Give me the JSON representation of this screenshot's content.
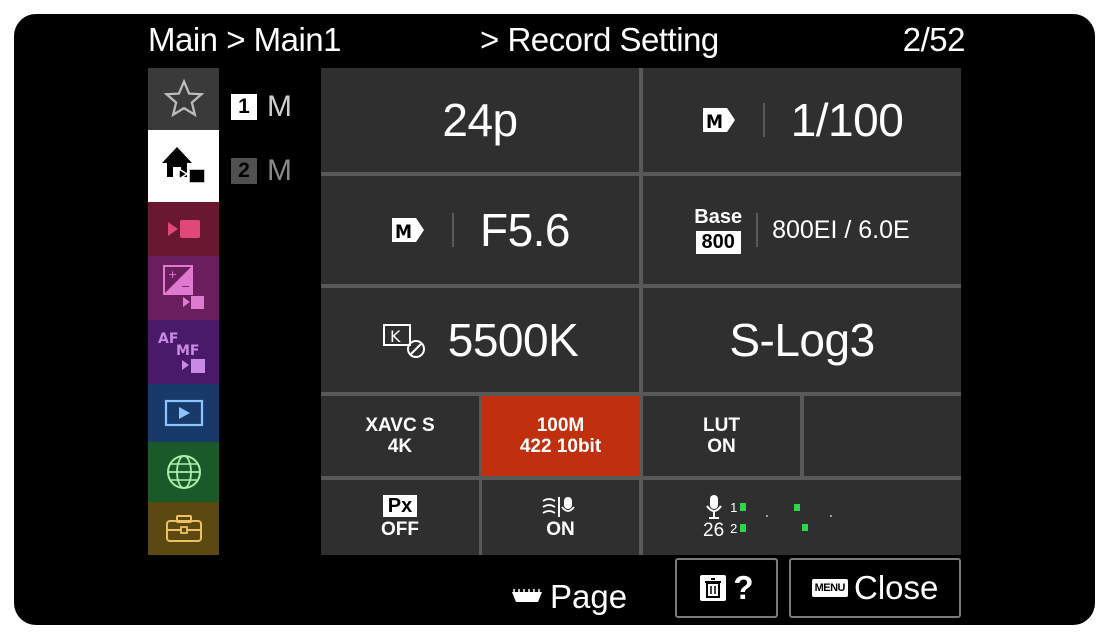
{
  "header": {
    "breadcrumb": "Main > Main1",
    "section": "> Record Setting",
    "page_indicator": "2/52"
  },
  "nav": {
    "items": [
      {
        "icon": "star-icon",
        "color": "#3a3a3a"
      },
      {
        "icon": "home-movie-icon",
        "color": "#ffffff",
        "selected": true
      },
      {
        "icon": "movie-camera-icon",
        "color": "#6a1830"
      },
      {
        "icon": "exposure-color-icon",
        "color": "#6a1e5e"
      },
      {
        "icon": "af-mf-icon",
        "color": "#4a1a6a"
      },
      {
        "icon": "playback-icon",
        "color": "#183a6a"
      },
      {
        "icon": "network-globe-icon",
        "color": "#1a5a2a"
      },
      {
        "icon": "toolbox-icon",
        "color": "#5a4a12"
      }
    ]
  },
  "slots": [
    {
      "num": "1",
      "label": "M"
    },
    {
      "num": "2",
      "label": "M"
    }
  ],
  "grid": {
    "frame_rate": "24p",
    "shutter_mode": "M",
    "shutter_speed": "1/100",
    "aperture_mode": "M",
    "aperture": "F5.6",
    "iso_base_label": "Base",
    "iso_base_value": "800",
    "exposure_index": "800EI / 6.0E",
    "white_balance": "5500K",
    "picture_profile": "S-Log3",
    "format_line1": "XAVC S",
    "format_line2": "4K",
    "bitrate_line1": "100M",
    "bitrate_line2": "422 10bit",
    "lut_line1": "LUT",
    "lut_line2": "ON",
    "px_label": "Px",
    "px_state": "OFF",
    "stabilizer_state": "ON",
    "audio_level": "26",
    "audio_ch1": "1",
    "audio_ch2": "2"
  },
  "colors": {
    "bitrate_highlight": "#c0300e",
    "meter_green": "#2fd64a"
  },
  "footer": {
    "page_label": "Page",
    "help_label": "?",
    "menu_badge": "MENU",
    "close_label": "Close"
  }
}
